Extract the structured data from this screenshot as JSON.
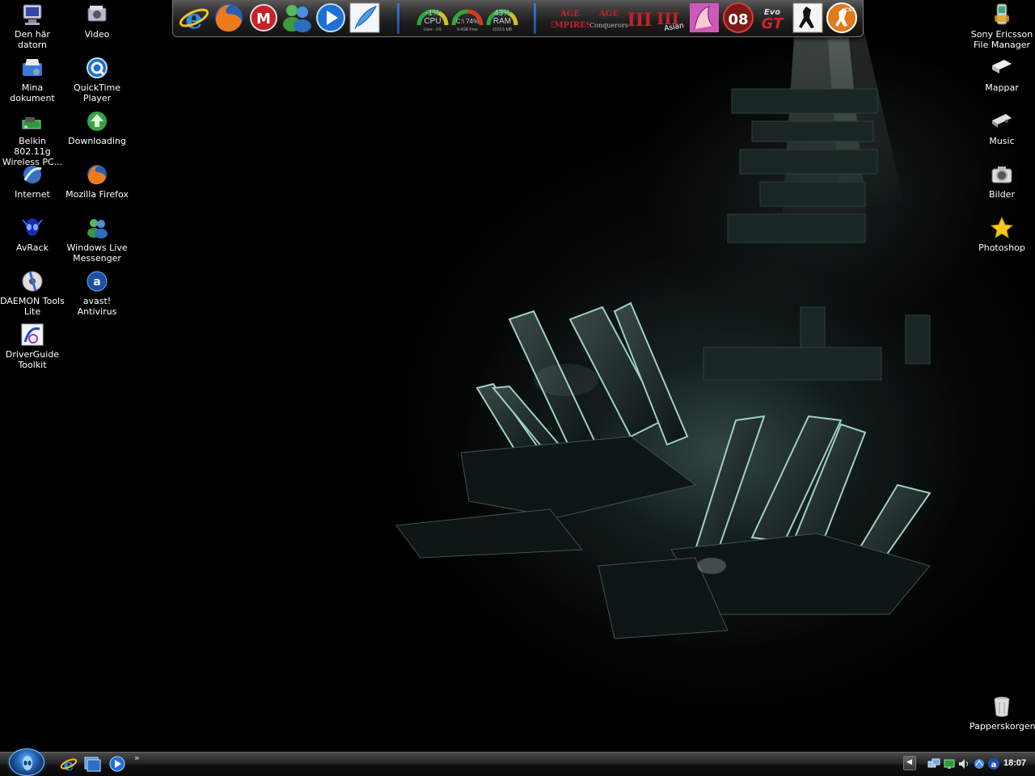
{
  "desktop": {
    "left_icons": [
      {
        "label": "Den här datorn",
        "icon": "computer-icon"
      },
      {
        "label": "Video",
        "icon": "video-folder-icon"
      },
      {
        "label": "Mina dokument",
        "icon": "documents-folder-icon"
      },
      {
        "label": "QuickTime\nPlayer",
        "icon": "quicktime-icon"
      },
      {
        "label": "Belkin 802.11g\nWireless PC...",
        "icon": "wireless-card-icon"
      },
      {
        "label": "Downloading",
        "icon": "download-icon"
      },
      {
        "label": "Internet",
        "icon": "internet-icon"
      },
      {
        "label": "Mozilla Firefox",
        "icon": "firefox-icon"
      },
      {
        "label": "AvRack",
        "icon": "alien-icon"
      },
      {
        "label": "Windows Live\nMessenger",
        "icon": "messenger-icon"
      },
      {
        "label": "DAEMON Tools\nLite",
        "icon": "daemon-tools-icon"
      },
      {
        "label": "avast! Antivirus",
        "icon": "avast-icon"
      },
      {
        "label": "DriverGuide\nToolkit",
        "icon": "driverguide-icon"
      }
    ],
    "right_icons": [
      {
        "label": "Sony Ericsson\nFile Manager",
        "icon": "phone-icon"
      },
      {
        "label": "Mappar",
        "icon": "folders-icon"
      },
      {
        "label": "Music",
        "icon": "music-icon"
      },
      {
        "label": "Bilder",
        "icon": "camera-icon"
      },
      {
        "label": "Photoshop",
        "icon": "star-icon"
      },
      {
        "label": "Papperskorgen",
        "icon": "recycle-bin-icon"
      }
    ]
  },
  "dock": {
    "apps": [
      "internet-explorer-icon",
      "firefox-icon",
      "mcafee-icon",
      "messenger-icon",
      "media-player-icon",
      "feather-icon"
    ],
    "gauges": [
      {
        "name": "CPU",
        "value": "-1%",
        "sub": "User: -1%"
      },
      {
        "name": "C:\\ 74%",
        "value": "",
        "sub": "9.4GB Free"
      },
      {
        "name": "RAM",
        "value": "43%",
        "sub": "1023.5 MB"
      }
    ],
    "games": [
      {
        "label": "AGE EMPIRES",
        "icon": "age-of-empires-icon"
      },
      {
        "label": "AGE Conquerors",
        "icon": "age-conquerors-icon"
      },
      {
        "label": "III",
        "icon": "age3-icon"
      },
      {
        "label": "Asian",
        "icon": "age3-asian-icon"
      },
      {
        "label": "",
        "icon": "vice-city-icon"
      },
      {
        "label": "08",
        "icon": "fifa08-icon"
      },
      {
        "label": "Evo GT",
        "icon": "racing-game-icon"
      },
      {
        "label": "",
        "icon": "counter-strike-icon"
      },
      {
        "label": "CSS",
        "icon": "counter-strike-source-icon"
      }
    ]
  },
  "taskbar": {
    "more": "»",
    "quick_launch": [
      "internet-explorer-icon",
      "show-desktop-icon",
      "media-player-icon"
    ],
    "tray": [
      "network-icon",
      "monitor-icon",
      "volume-icon",
      "network-activity-icon",
      "avast-icon"
    ],
    "clock": "18:07"
  },
  "colors": {
    "accent": "#3a7bd5",
    "desktop": "#000000"
  }
}
